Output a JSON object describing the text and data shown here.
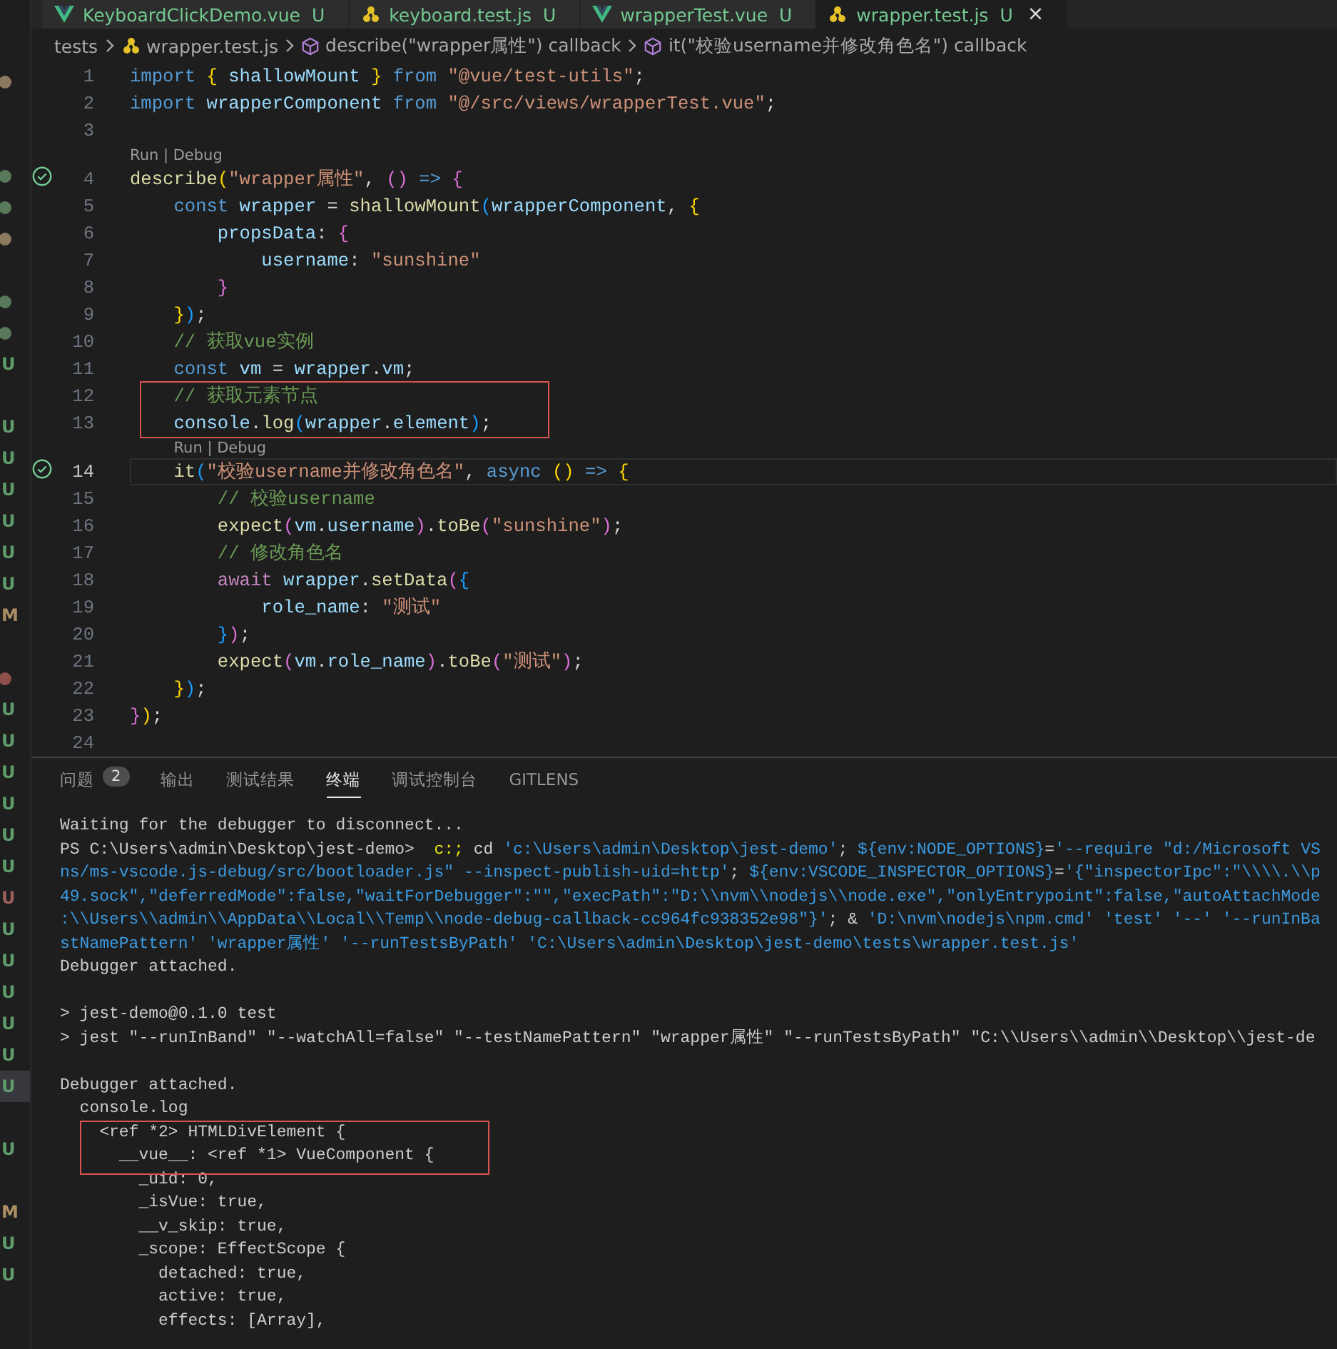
{
  "explorer_badges": [
    {
      "kind": "dot",
      "color": "#8c7a5e",
      "selected": false
    },
    {
      "kind": "blank",
      "selected": false
    },
    {
      "kind": "blank",
      "selected": false
    },
    {
      "kind": "dot",
      "color": "#587a5a",
      "selected": false
    },
    {
      "kind": "dot",
      "color": "#587a5a",
      "selected": false
    },
    {
      "kind": "dot",
      "color": "#8c7a5e",
      "selected": false
    },
    {
      "kind": "blank",
      "selected": false
    },
    {
      "kind": "dot",
      "color": "#587a5a",
      "selected": false
    },
    {
      "kind": "dot",
      "color": "#587a5a",
      "selected": false
    },
    {
      "kind": "letter",
      "text": "U",
      "color": "#5f9c6b",
      "selected": false
    },
    {
      "kind": "blank",
      "selected": false
    },
    {
      "kind": "letter",
      "text": "U",
      "color": "#5f9c6b",
      "selected": false
    },
    {
      "kind": "letter",
      "text": "U",
      "color": "#5f9c6b",
      "selected": false
    },
    {
      "kind": "letter",
      "text": "U",
      "color": "#5f9c6b",
      "selected": false
    },
    {
      "kind": "letter",
      "text": "U",
      "color": "#5f9c6b",
      "selected": false
    },
    {
      "kind": "letter",
      "text": "U",
      "color": "#5f9c6b",
      "selected": false
    },
    {
      "kind": "letter",
      "text": "U",
      "color": "#5f9c6b",
      "selected": false
    },
    {
      "kind": "letter",
      "text": "M",
      "color": "#a98e63",
      "selected": false
    },
    {
      "kind": "blank",
      "selected": false
    },
    {
      "kind": "dot",
      "color": "#8c4f4a",
      "selected": false
    },
    {
      "kind": "letter",
      "text": "U",
      "color": "#5f9c6b",
      "selected": false
    },
    {
      "kind": "letter",
      "text": "U",
      "color": "#5f9c6b",
      "selected": false
    },
    {
      "kind": "letter",
      "text": "U",
      "color": "#5f9c6b",
      "selected": false
    },
    {
      "kind": "letter",
      "text": "U",
      "color": "#5f9c6b",
      "selected": false
    },
    {
      "kind": "letter",
      "text": "U",
      "color": "#5f9c6b",
      "selected": false
    },
    {
      "kind": "letter",
      "text": "U",
      "color": "#5f9c6b",
      "selected": false
    },
    {
      "kind": "letter",
      "text": "U",
      "color": "#9c5f5a",
      "selected": false
    },
    {
      "kind": "letter",
      "text": "U",
      "color": "#5f9c6b",
      "selected": false
    },
    {
      "kind": "letter",
      "text": "U",
      "color": "#5f9c6b",
      "selected": false
    },
    {
      "kind": "letter",
      "text": "U",
      "color": "#5f9c6b",
      "selected": false
    },
    {
      "kind": "letter",
      "text": "U",
      "color": "#5f9c6b",
      "selected": false
    },
    {
      "kind": "letter",
      "text": "U",
      "color": "#5f9c6b",
      "selected": false
    },
    {
      "kind": "letter",
      "text": "U",
      "color": "#5f9c6b",
      "selected": true
    },
    {
      "kind": "blank",
      "selected": false
    },
    {
      "kind": "letter",
      "text": "U",
      "color": "#5f9c6b",
      "selected": false
    },
    {
      "kind": "blank",
      "selected": false
    },
    {
      "kind": "letter",
      "text": "M",
      "color": "#a98e63",
      "selected": false
    },
    {
      "kind": "letter",
      "text": "U",
      "color": "#5f9c6b",
      "selected": false
    },
    {
      "kind": "letter",
      "text": "U",
      "color": "#5f9c6b",
      "selected": false
    }
  ],
  "tabs": [
    {
      "label": "KeyboardClickDemo.vue",
      "status": "U",
      "kind": "vue",
      "selected": false
    },
    {
      "label": "keyboard.test.js",
      "status": "U",
      "kind": "test",
      "selected": false
    },
    {
      "label": "wrapperTest.vue",
      "status": "U",
      "kind": "vue",
      "selected": false
    },
    {
      "label": "wrapper.test.js",
      "status": "U",
      "kind": "test",
      "selected": true,
      "close": "×"
    }
  ],
  "breadcrumb": [
    {
      "kind": "folder",
      "text": "tests"
    },
    {
      "kind": "test",
      "text": "wrapper.test.js"
    },
    {
      "kind": "symbol",
      "text": "describe(\"wrapper属性\") callback"
    },
    {
      "kind": "symbol",
      "text": "it(\"校验username并修改角色名\") callback"
    }
  ],
  "code_lines": [
    {
      "number": "1",
      "tokens": [
        {
          "kind": "kw",
          "text": "import "
        },
        {
          "kind": "b1",
          "text": "{"
        },
        {
          "kind": "var",
          "text": " shallowMount "
        },
        {
          "kind": "b1",
          "text": "}"
        },
        {
          "kind": "kw",
          "text": " from "
        },
        {
          "kind": "str",
          "text": "\"@vue/test-utils\""
        },
        {
          "kind": "p",
          "text": ";"
        }
      ]
    },
    {
      "number": "2",
      "tokens": [
        {
          "kind": "kw",
          "text": "import "
        },
        {
          "kind": "var",
          "text": "wrapperComponent"
        },
        {
          "kind": "kw",
          "text": " from "
        },
        {
          "kind": "str",
          "text": "\"@/src/views/wrapperTest.vue\""
        },
        {
          "kind": "p",
          "text": ";"
        }
      ]
    },
    {
      "number": "3"
    },
    {
      "number": "4",
      "codelens": "Run | Debug",
      "test_passed": true,
      "tokens": [
        {
          "kind": "fn",
          "text": "describe"
        },
        {
          "kind": "b1",
          "text": "("
        },
        {
          "kind": "str",
          "text": "\"wrapper属性\""
        },
        {
          "kind": "p",
          "text": ", "
        },
        {
          "kind": "b2",
          "text": "()"
        },
        {
          "kind": "kw",
          "text": " =>"
        },
        {
          "kind": "b2",
          "text": " {"
        }
      ]
    },
    {
      "number": "5",
      "tokens": [
        {
          "kind": "kw",
          "text": "    const"
        },
        {
          "kind": "var",
          "text": " wrapper"
        },
        {
          "kind": "p",
          "text": " = "
        },
        {
          "kind": "fn",
          "text": "shallowMount"
        },
        {
          "kind": "b3",
          "text": "("
        },
        {
          "kind": "var",
          "text": "wrapperComponent"
        },
        {
          "kind": "p",
          "text": ", "
        },
        {
          "kind": "b1",
          "text": "{"
        }
      ]
    },
    {
      "number": "6",
      "tokens": [
        {
          "kind": "var",
          "text": "        propsData"
        },
        {
          "kind": "p",
          "text": ": "
        },
        {
          "kind": "b2",
          "text": "{"
        }
      ]
    },
    {
      "number": "7",
      "tokens": [
        {
          "kind": "var",
          "text": "            username"
        },
        {
          "kind": "p",
          "text": ": "
        },
        {
          "kind": "str",
          "text": "\"sunshine\""
        }
      ]
    },
    {
      "number": "8",
      "tokens": [
        {
          "kind": "b2",
          "text": "        }"
        }
      ]
    },
    {
      "number": "9",
      "tokens": [
        {
          "kind": "b1",
          "text": "    }"
        },
        {
          "kind": "b3",
          "text": ")"
        },
        {
          "kind": "p",
          "text": ";"
        }
      ]
    },
    {
      "number": "10",
      "tokens": [
        {
          "kind": "cm",
          "text": "    // 获取vue实例"
        }
      ]
    },
    {
      "number": "11",
      "tokens": [
        {
          "kind": "kw",
          "text": "    const"
        },
        {
          "kind": "var",
          "text": " vm"
        },
        {
          "kind": "p",
          "text": " = "
        },
        {
          "kind": "var",
          "text": "wrapper"
        },
        {
          "kind": "p",
          "text": "."
        },
        {
          "kind": "var",
          "text": "vm"
        },
        {
          "kind": "p",
          "text": ";"
        }
      ]
    },
    {
      "number": "12",
      "boxed": true,
      "tokens": [
        {
          "kind": "cm",
          "text": "    // 获取元素节点"
        }
      ]
    },
    {
      "number": "13",
      "boxed": true,
      "tokens": [
        {
          "kind": "var",
          "text": "    console"
        },
        {
          "kind": "p",
          "text": "."
        },
        {
          "kind": "fn",
          "text": "log"
        },
        {
          "kind": "b3",
          "text": "("
        },
        {
          "kind": "var",
          "text": "wrapper"
        },
        {
          "kind": "p",
          "text": "."
        },
        {
          "kind": "var",
          "text": "element"
        },
        {
          "kind": "b3",
          "text": ")"
        },
        {
          "kind": "p",
          "text": ";"
        }
      ]
    },
    {
      "number": "14",
      "codelens": "Run | Debug",
      "test_passed": true,
      "current": true,
      "tokens": [
        {
          "kind": "fn",
          "text": "    it"
        },
        {
          "kind": "b3",
          "text": "("
        },
        {
          "kind": "str",
          "text": "\"校验username并修改角色名\""
        },
        {
          "kind": "p",
          "text": ", "
        },
        {
          "kind": "kw",
          "text": "async "
        },
        {
          "kind": "b1",
          "text": "()"
        },
        {
          "kind": "kw",
          "text": " =>"
        },
        {
          "kind": "b1",
          "text": " {"
        }
      ]
    },
    {
      "number": "15",
      "tokens": [
        {
          "kind": "cm",
          "text": "        // 校验username"
        }
      ]
    },
    {
      "number": "16",
      "tokens": [
        {
          "kind": "fn",
          "text": "        expect"
        },
        {
          "kind": "b2",
          "text": "("
        },
        {
          "kind": "var",
          "text": "vm"
        },
        {
          "kind": "p",
          "text": "."
        },
        {
          "kind": "var",
          "text": "username"
        },
        {
          "kind": "b2",
          "text": ")"
        },
        {
          "kind": "p",
          "text": "."
        },
        {
          "kind": "fn",
          "text": "toBe"
        },
        {
          "kind": "b2",
          "text": "("
        },
        {
          "kind": "str",
          "text": "\"sunshine\""
        },
        {
          "kind": "b2",
          "text": ")"
        },
        {
          "kind": "p",
          "text": ";"
        }
      ]
    },
    {
      "number": "17",
      "tokens": [
        {
          "kind": "cm",
          "text": "        // 修改角色名"
        }
      ]
    },
    {
      "number": "18",
      "tokens": [
        {
          "kind": "ctrl",
          "text": "        await"
        },
        {
          "kind": "var",
          "text": " wrapper"
        },
        {
          "kind": "p",
          "text": "."
        },
        {
          "kind": "fn",
          "text": "setData"
        },
        {
          "kind": "b2",
          "text": "("
        },
        {
          "kind": "b3",
          "text": "{"
        }
      ]
    },
    {
      "number": "19",
      "tokens": [
        {
          "kind": "var",
          "text": "            role_name"
        },
        {
          "kind": "p",
          "text": ": "
        },
        {
          "kind": "str",
          "text": "\"测试\""
        }
      ]
    },
    {
      "number": "20",
      "tokens": [
        {
          "kind": "b3",
          "text": "        }"
        },
        {
          "kind": "b2",
          "text": ")"
        },
        {
          "kind": "p",
          "text": ";"
        }
      ]
    },
    {
      "number": "21",
      "tokens": [
        {
          "kind": "fn",
          "text": "        expect"
        },
        {
          "kind": "b2",
          "text": "("
        },
        {
          "kind": "var",
          "text": "vm"
        },
        {
          "kind": "p",
          "text": "."
        },
        {
          "kind": "var",
          "text": "role_name"
        },
        {
          "kind": "b2",
          "text": ")"
        },
        {
          "kind": "p",
          "text": "."
        },
        {
          "kind": "fn",
          "text": "toBe"
        },
        {
          "kind": "b2",
          "text": "("
        },
        {
          "kind": "str",
          "text": "\"测试\""
        },
        {
          "kind": "b2",
          "text": ")"
        },
        {
          "kind": "p",
          "text": ";"
        }
      ]
    },
    {
      "number": "22",
      "tokens": [
        {
          "kind": "b1",
          "text": "    }"
        },
        {
          "kind": "b3",
          "text": ")"
        },
        {
          "kind": "p",
          "text": ";"
        }
      ]
    },
    {
      "number": "23",
      "tokens": [
        {
          "kind": "b2",
          "text": "}"
        },
        {
          "kind": "b1",
          "text": ")"
        },
        {
          "kind": "p",
          "text": ";"
        }
      ]
    },
    {
      "number": "24"
    }
  ],
  "panel_tabs": [
    {
      "label": "问题",
      "badge": "2",
      "selected": false
    },
    {
      "label": "输出",
      "selected": false
    },
    {
      "label": "测试结果",
      "selected": false
    },
    {
      "label": "终端",
      "selected": true
    },
    {
      "label": "调试控制台",
      "selected": false
    },
    {
      "label": "GITLENS",
      "selected": false
    }
  ],
  "terminal_lines": [
    {
      "tokens": [
        {
          "kind": "w",
          "text": "Waiting for the debugger to disconnect..."
        }
      ]
    },
    {
      "tokens": [
        {
          "kind": "w",
          "text": "PS C:\\Users\\admin\\Desktop\\jest-demo>"
        },
        {
          "kind": "y",
          "text": "  c:;"
        },
        {
          "kind": "w",
          "text": " cd "
        },
        {
          "kind": "c",
          "text": "'c:\\Users\\admin\\Desktop\\jest-demo'"
        },
        {
          "kind": "w",
          "text": "; "
        },
        {
          "kind": "c",
          "text": "${env:NODE_OPTIONS}"
        },
        {
          "kind": "w",
          "text": "="
        },
        {
          "kind": "c",
          "text": "'--require \"d:/Microsoft VS"
        }
      ]
    },
    {
      "tokens": [
        {
          "kind": "c",
          "text": "ns/ms-vscode.js-debug/src/bootloader.js\" --inspect-publish-uid=http'"
        },
        {
          "kind": "w",
          "text": "; "
        },
        {
          "kind": "c",
          "text": "${env:VSCODE_INSPECTOR_OPTIONS}"
        },
        {
          "kind": "w",
          "text": "="
        },
        {
          "kind": "c",
          "text": "'{\"inspectorIpc\":\"\\\\\\\\.\\\\p"
        }
      ]
    },
    {
      "tokens": [
        {
          "kind": "c",
          "text": "49.sock\",\"deferredMode\":false,\"waitForDebugger\":\"\",\"execPath\":\"D:\\\\nvm\\\\nodejs\\\\node.exe\",\"onlyEntrypoint\":false,\"autoAttachMode"
        }
      ]
    },
    {
      "tokens": [
        {
          "kind": "c",
          "text": ":\\\\Users\\\\admin\\\\AppData\\\\Local\\\\Temp\\\\node-debug-callback-cc964fc938352e98\"}'"
        },
        {
          "kind": "w",
          "text": "; & "
        },
        {
          "kind": "c",
          "text": "'D:\\nvm\\nodejs\\npm.cmd' 'test' '--' '--runInBa"
        }
      ]
    },
    {
      "tokens": [
        {
          "kind": "c",
          "text": "stNamePattern' 'wrapper属性' '--runTestsByPath' 'C:\\Users\\admin\\Desktop\\jest-demo\\tests\\wrapper.test.js'"
        }
      ]
    },
    {
      "tokens": [
        {
          "kind": "w",
          "text": "Debugger attached."
        }
      ]
    },
    {
      "kind": "blank"
    },
    {
      "tokens": [
        {
          "kind": "w",
          "text": "> jest-demo@0.1.0 test"
        }
      ]
    },
    {
      "tokens": [
        {
          "kind": "w",
          "text": "> jest \"--runInBand\" \"--watchAll=false\" \"--testNamePattern\" \"wrapper属性\" \"--runTestsByPath\" \"C:\\\\Users\\\\admin\\\\Desktop\\\\jest-de"
        }
      ]
    },
    {
      "kind": "blank"
    },
    {
      "tokens": [
        {
          "kind": "w",
          "text": "Debugger attached."
        }
      ]
    },
    {
      "tokens": [
        {
          "kind": "w",
          "text": "  console.log"
        }
      ]
    },
    {
      "boxed": true,
      "tokens": [
        {
          "kind": "w",
          "text": "    <ref *2> HTMLDivElement {"
        }
      ]
    },
    {
      "boxed": true,
      "tokens": [
        {
          "kind": "w",
          "text": "      __vue__: <ref *1> VueComponent {"
        }
      ]
    },
    {
      "tokens": [
        {
          "kind": "w",
          "text": "        _uid: 0,"
        }
      ]
    },
    {
      "tokens": [
        {
          "kind": "w",
          "text": "        _isVue: true,"
        }
      ]
    },
    {
      "tokens": [
        {
          "kind": "w",
          "text": "        __v_skip: true,"
        }
      ]
    },
    {
      "tokens": [
        {
          "kind": "w",
          "text": "        _scope: EffectScope {"
        }
      ]
    },
    {
      "tokens": [
        {
          "kind": "w",
          "text": "          detached: true,"
        }
      ]
    },
    {
      "tokens": [
        {
          "kind": "w",
          "text": "          active: true,"
        }
      ]
    },
    {
      "tokens": [
        {
          "kind": "w",
          "text": "          effects: [Array],"
        }
      ]
    }
  ]
}
